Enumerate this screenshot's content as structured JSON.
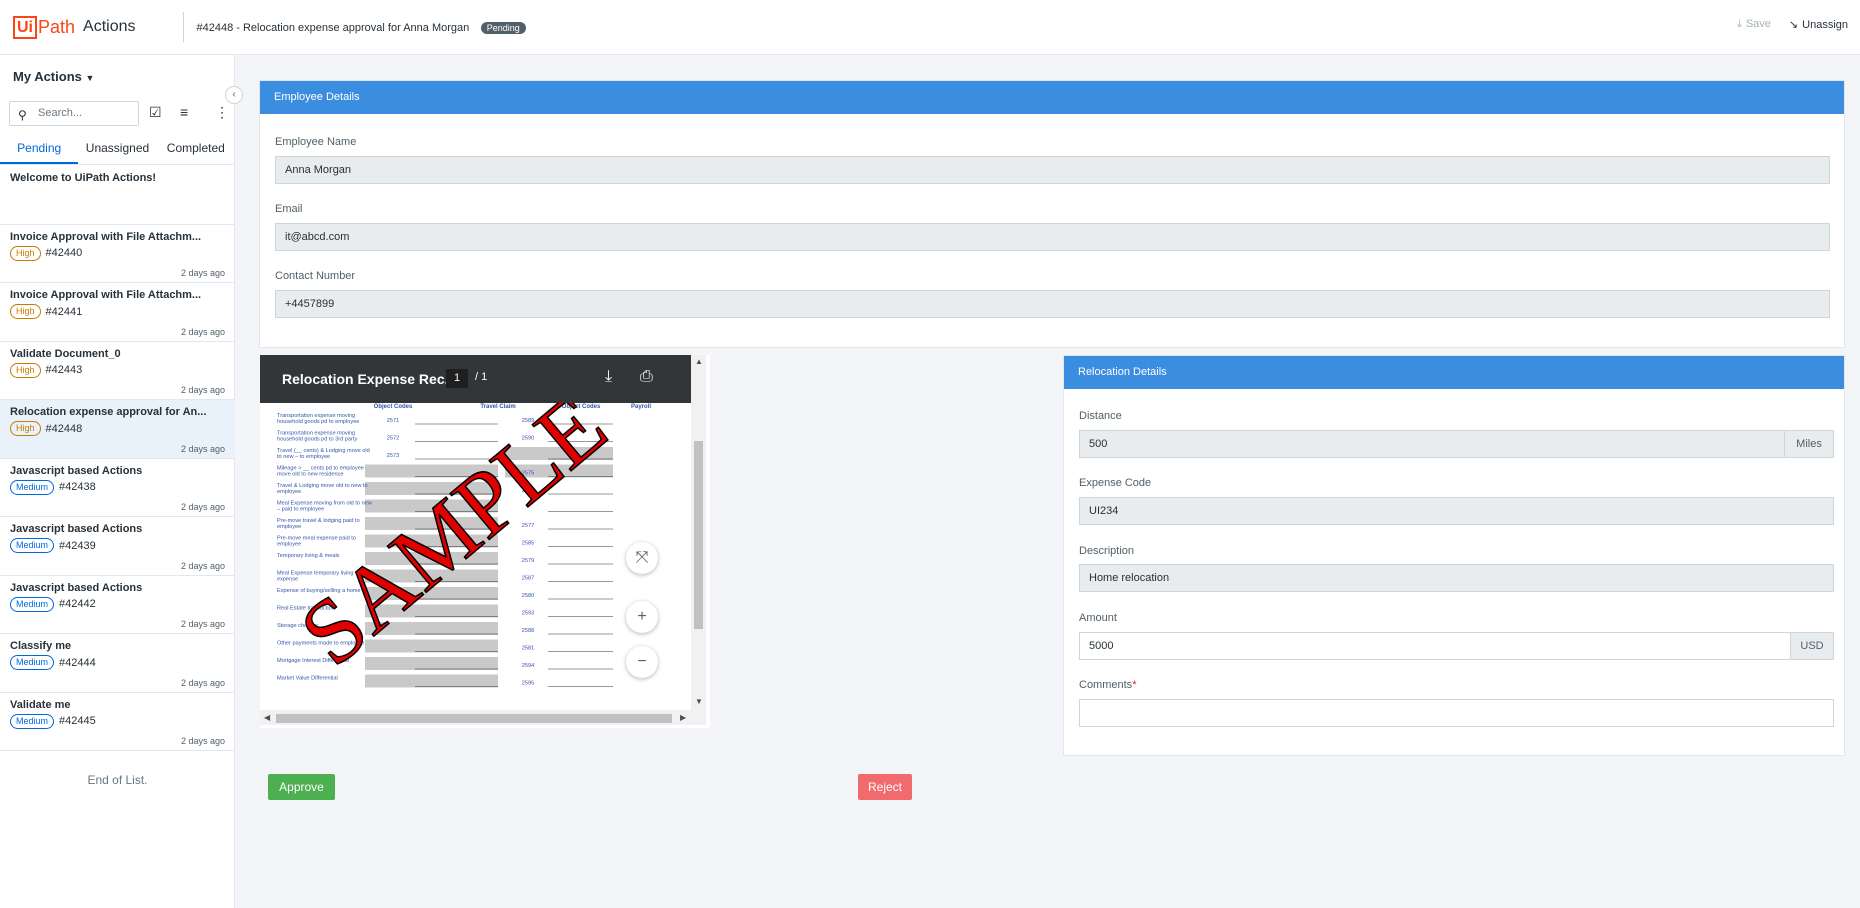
{
  "header": {
    "logo_box": "Ui",
    "logo_path": "Path",
    "logo_product": "Actions",
    "task_title": "#42448 - Relocation expense approval for Anna Morgan",
    "status": "Pending",
    "save_label": "Save",
    "unassign_label": "Unassign"
  },
  "sidebar": {
    "title": "My Actions",
    "search_placeholder": "Search...",
    "tabs": [
      "Pending",
      "Unassigned",
      "Completed"
    ],
    "items": [
      {
        "title": "Welcome to UiPath Actions!",
        "priority": "",
        "id": "",
        "time": ""
      },
      {
        "title": "Invoice Approval with File Attachm...",
        "priority": "High",
        "id": "#42440",
        "time": "2 days ago"
      },
      {
        "title": "Invoice Approval with File Attachm...",
        "priority": "High",
        "id": "#42441",
        "time": "2 days ago"
      },
      {
        "title": "Validate Document_0",
        "priority": "High",
        "id": "#42443",
        "time": "2 days ago"
      },
      {
        "title": "Relocation expense approval for An...",
        "priority": "High",
        "id": "#42448",
        "time": "2 days ago"
      },
      {
        "title": "Javascript based Actions",
        "priority": "Medium",
        "id": "#42438",
        "time": "2 days ago"
      },
      {
        "title": "Javascript based Actions",
        "priority": "Medium",
        "id": "#42439",
        "time": "2 days ago"
      },
      {
        "title": "Javascript based Actions",
        "priority": "Medium",
        "id": "#42442",
        "time": "2 days ago"
      },
      {
        "title": "Classify me",
        "priority": "Medium",
        "id": "#42444",
        "time": "2 days ago"
      },
      {
        "title": "Validate me",
        "priority": "Medium",
        "id": "#42445",
        "time": "2 days ago"
      }
    ],
    "end_text": "End of List."
  },
  "employee": {
    "header": "Employee Details",
    "name_label": "Employee Name",
    "name_value": "Anna Morgan",
    "email_label": "Email",
    "email_value": "it@abcd.com",
    "contact_label": "Contact Number",
    "contact_value": "+4457899"
  },
  "viewer": {
    "title": "Relocation Expense Rec...",
    "page": "1",
    "total": "1",
    "watermark": "SAMPLE",
    "col_headers": [
      "Object Codes",
      "Travel Claim",
      "Object Codes",
      "Payroll"
    ],
    "rows": [
      {
        "desc": "Transportation expense moving household goods pd to employee",
        "code1": "2571",
        "code2": "2589"
      },
      {
        "desc": "Transportation expense moving household goods pd to 3rd party",
        "code1": "2572",
        "code2": "2590"
      },
      {
        "desc": "Travel (__ cents) & Lodging move old to new – to employee",
        "code1": "2573",
        "code2": ""
      },
      {
        "desc": "Mileage > __ cents pd to employee move old to new residence",
        "code1": "",
        "code2": "2575"
      },
      {
        "desc": "Travel & Lodging move old to new to employee",
        "code1": "",
        "code2": "2591"
      },
      {
        "desc": "Meal Expense moving from old to new – paid to employee",
        "code1": "",
        "code2": ""
      },
      {
        "desc": "Pre-move travel & lodging paid to employee",
        "code1": "",
        "code2": "2577"
      },
      {
        "desc": "Pre-move meal expense paid to employee",
        "code1": "",
        "code2": "2585"
      },
      {
        "desc": "Temporary living & meals",
        "code1": "",
        "code2": "2579"
      },
      {
        "desc": "Meal Expense temporary living expense",
        "code1": "",
        "code2": "2587"
      },
      {
        "desc": "Expense of buying/selling a home",
        "code1": "",
        "code2": "2580"
      },
      {
        "desc": "Real Estate transaction",
        "code1": "",
        "code2": "2593"
      },
      {
        "desc": "Storage charges",
        "code1": "",
        "code2": "2588"
      },
      {
        "desc": "Other payments made to employee",
        "code1": "",
        "code2": "2581"
      },
      {
        "desc": "Mortgage Interest Differential",
        "code1": "",
        "code2": "2594"
      },
      {
        "desc": "Market Value Differential",
        "code1": "",
        "code2": "2595"
      }
    ]
  },
  "relocation": {
    "header": "Relocation Details",
    "distance_label": "Distance",
    "distance_value": "500",
    "distance_unit": "Miles",
    "code_label": "Expense Code",
    "code_value": "UI234",
    "desc_label": "Description",
    "desc_value": "Home relocation",
    "amount_label": "Amount",
    "amount_value": "5000",
    "amount_unit": "USD",
    "comments_label": "Comments",
    "comments_required": "*",
    "comments_value": ""
  },
  "buttons": {
    "approve": "Approve",
    "reject": "Reject"
  },
  "colors": {
    "brand": "#fa4616",
    "section_header": "#3b8de0",
    "approve": "#4caf50",
    "reject": "#f06a6e"
  }
}
